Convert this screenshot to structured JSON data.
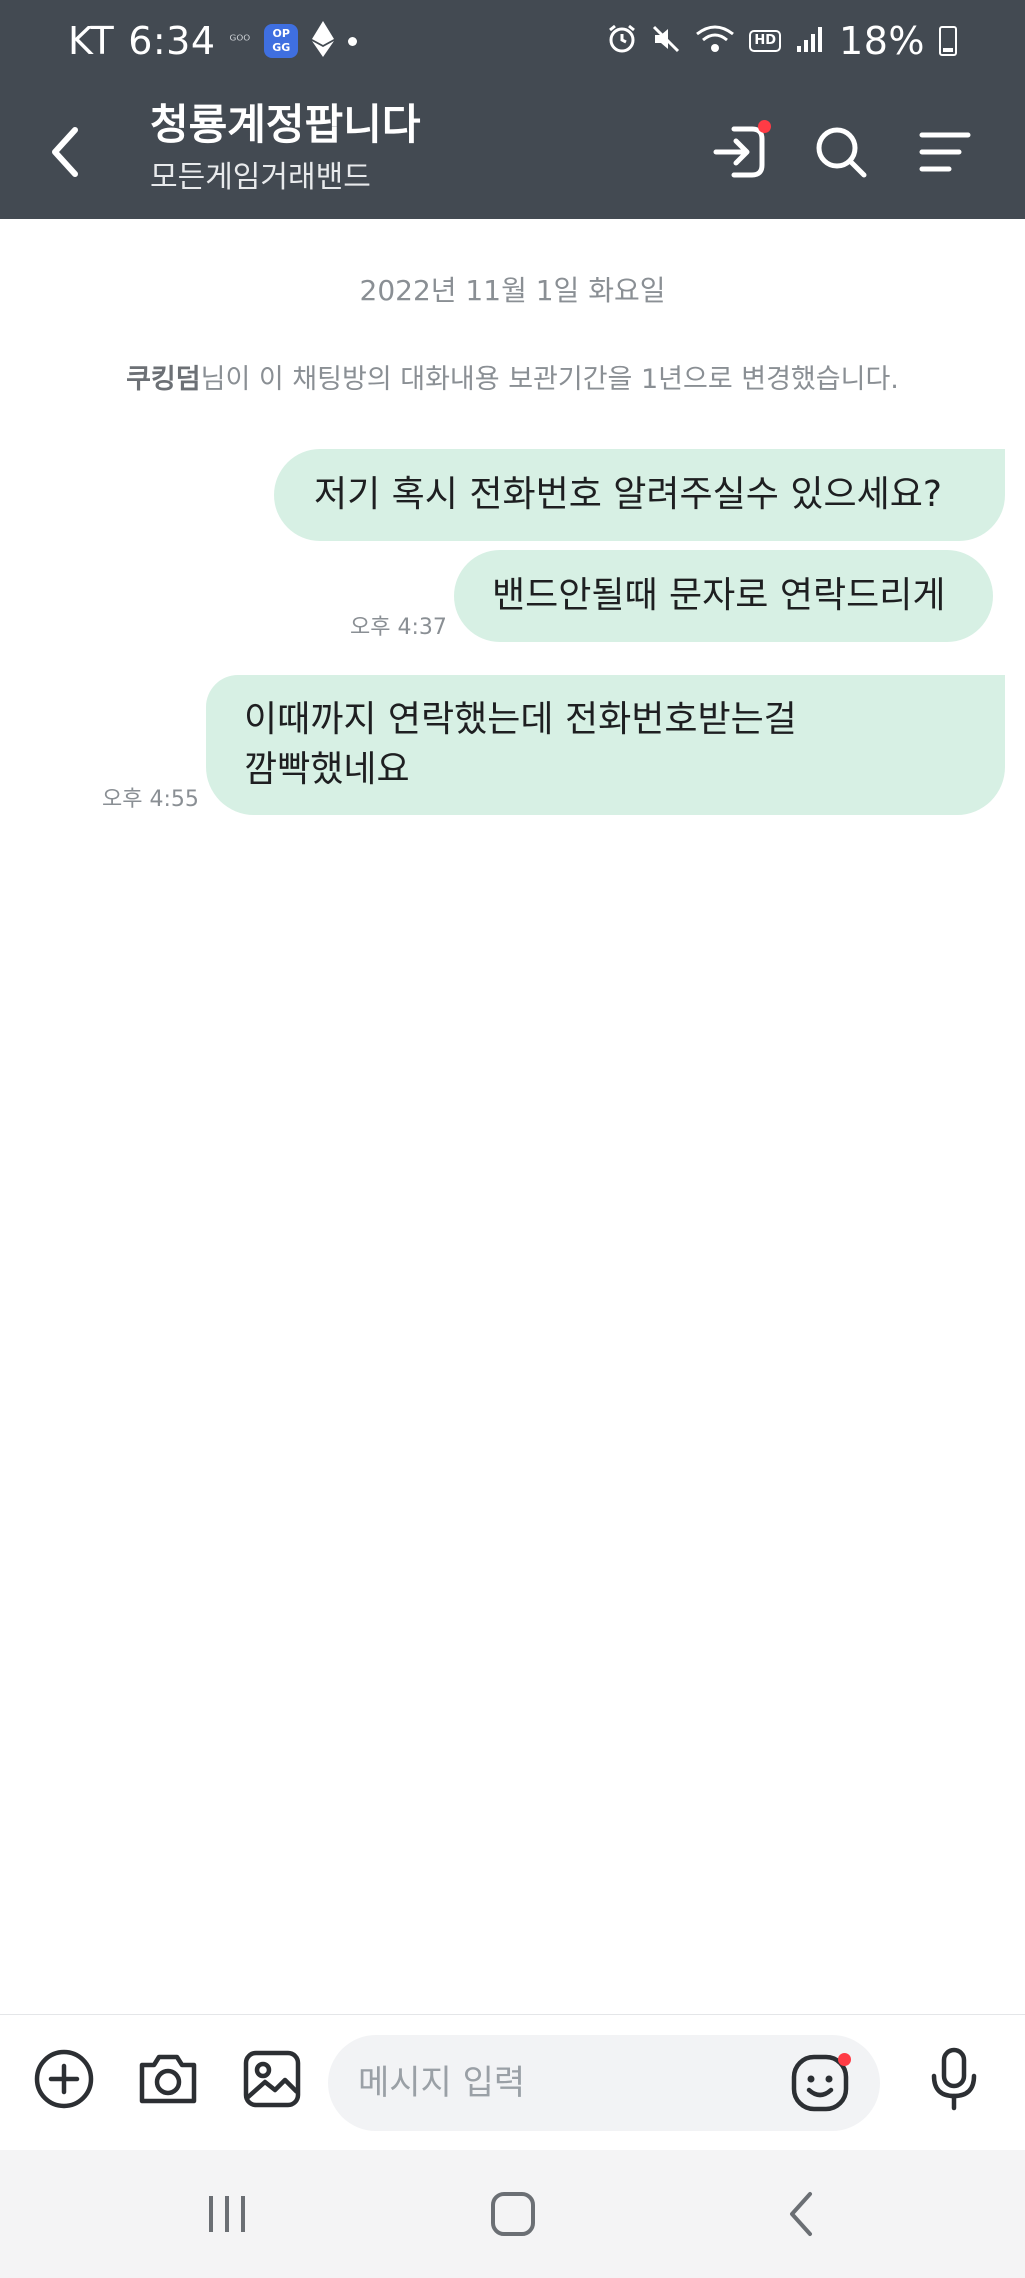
{
  "status_bar": {
    "carrier": "KT",
    "time": "6:34",
    "mini_icon_text": "ᴳᴼᴼ",
    "opgg_label": "OP\nGG",
    "hd_label": "HD",
    "battery": "18%"
  },
  "header": {
    "title": "청룡계정팝니다",
    "subtitle": "모든게임거래밴드"
  },
  "chat": {
    "date_separator": "2022년 11월 1일 화요일",
    "system_message": {
      "user": "쿠킹덤",
      "text": "님이 이 채팅방의 대화내용 보관기간을 1년으로 변경했습니다."
    },
    "messages": [
      {
        "text": "저기 혹시 전화번호 알려주실수 있으세요?",
        "time": ""
      },
      {
        "text": "밴드안될때 문자로 연락드리게",
        "time": "오후 4:37"
      },
      {
        "line1": "이때까지 연락했는데 전화번호받는걸",
        "line2": "깜빡했네요",
        "time": "오후 4:55"
      }
    ]
  },
  "input_bar": {
    "placeholder": "메시지 입력"
  },
  "colors": {
    "header_bg": "#434a52",
    "bubble_bg": "#d7f0e4",
    "notification_dot": "#ff3b45"
  }
}
